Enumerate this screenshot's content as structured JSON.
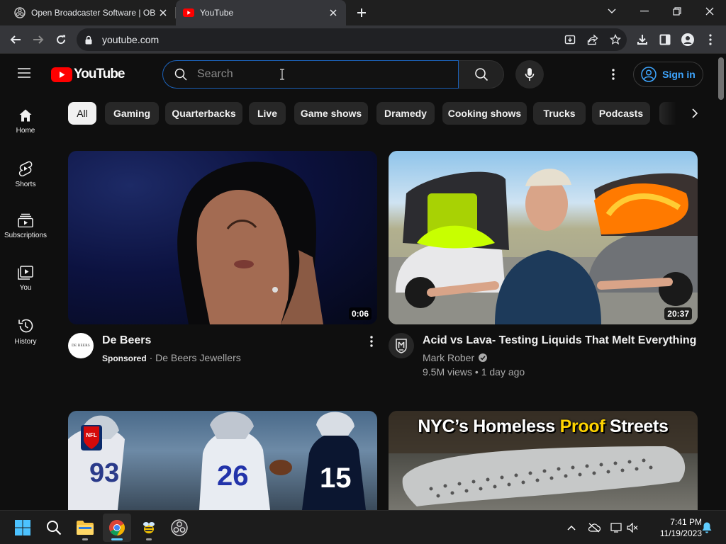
{
  "browser": {
    "tabs": [
      {
        "title": "Open Broadcaster Software | OBS",
        "favicon": "obs-icon",
        "active": false
      },
      {
        "title": "YouTube",
        "favicon": "youtube-icon",
        "active": true
      }
    ],
    "url": "youtube.com"
  },
  "youtube": {
    "logo_text": "YouTube",
    "search_placeholder": "Search",
    "signin_label": "Sign in",
    "sidebar": [
      {
        "label": "Home",
        "icon": "home-icon"
      },
      {
        "label": "Shorts",
        "icon": "shorts-icon"
      },
      {
        "label": "Subscriptions",
        "icon": "subscriptions-icon"
      },
      {
        "label": "You",
        "icon": "you-icon"
      },
      {
        "label": "History",
        "icon": "history-icon"
      }
    ],
    "chips": [
      "All",
      "Gaming",
      "Quarterbacks",
      "Live",
      "Game shows",
      "Dramedy",
      "Cooking shows",
      "Trucks",
      "Podcasts"
    ],
    "videos": [
      {
        "title": "De Beers",
        "sponsored_label": "Sponsored",
        "separator": "·",
        "advertiser": "De Beers Jewellers",
        "duration": "0:06",
        "avatar_text": "DE BEERS"
      },
      {
        "title": "Acid vs Lava- Testing Liquids That Melt Everything",
        "channel": "Mark Rober",
        "stats": "9.5M views • 1 day ago",
        "duration": "20:37",
        "verified": true
      },
      {
        "title": "",
        "thumb_description": "",
        "jersey_numbers": [
          "93",
          "26",
          "15"
        ],
        "logo_text": "NFL"
      },
      {
        "thumb_text_1": "NYC’s Homeless ",
        "thumb_text_2": "Proof",
        "thumb_text_3": " Streets"
      }
    ]
  },
  "taskbar": {
    "time": "7:41 PM",
    "date": "11/19/2023"
  },
  "colors": {
    "youtube_red": "#ff0000",
    "link_blue": "#3ea6ff",
    "search_focus": "#1c62b9",
    "highlight_yellow": "#ffd400"
  }
}
